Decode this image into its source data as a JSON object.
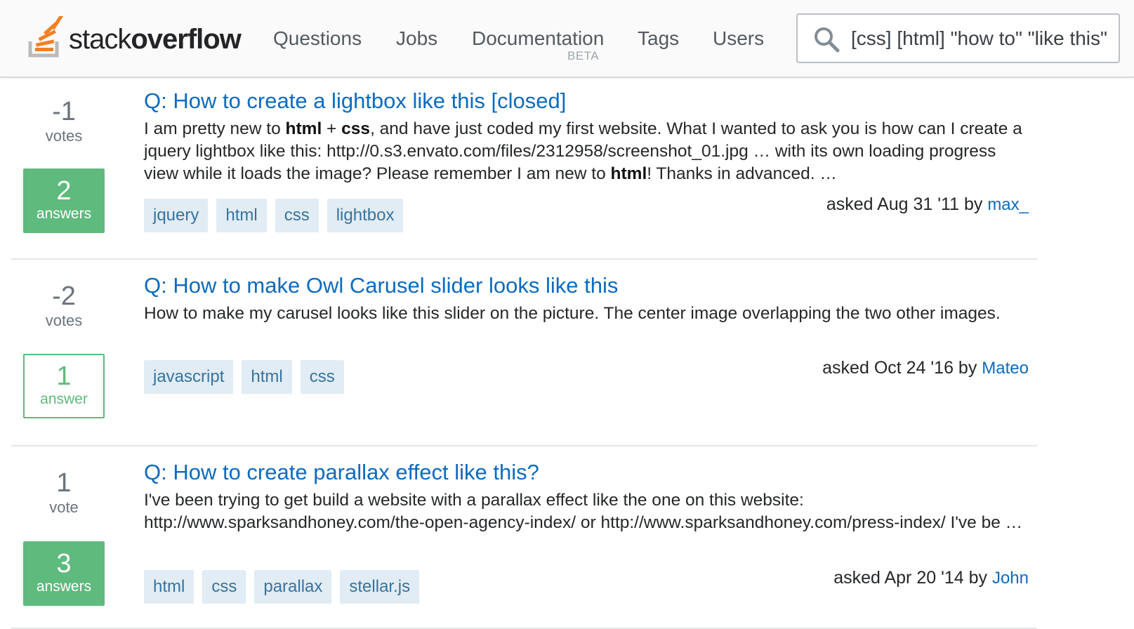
{
  "header": {
    "logo": {
      "light": "stack",
      "bold": "overflow"
    },
    "nav": [
      {
        "label": "Questions"
      },
      {
        "label": "Jobs"
      },
      {
        "label": "Documentation",
        "badge": "BETA"
      },
      {
        "label": "Tags"
      },
      {
        "label": "Users"
      }
    ],
    "search": {
      "value": "[css] [html] \"how to\" \"like this\"",
      "icon": "search-icon"
    }
  },
  "results": [
    {
      "votes": "-1",
      "votes_label": "votes",
      "answers": "2",
      "answers_label": "answers",
      "accepted": true,
      "title": "Q: How to create a lightbox like this [closed]",
      "excerpt": [
        {
          "t": "I am pretty new to "
        },
        {
          "t": "html",
          "b": true
        },
        {
          "t": " + "
        },
        {
          "t": "css",
          "b": true
        },
        {
          "t": ", and have just coded my first website. What I wanted to ask you is how can I create a jquery lightbox like this: http://0.s3.envato.com/files/2312958/screenshot_01.jpg … with its own loading progress view while it loads the image? Please remember I am new to "
        },
        {
          "t": "html",
          "b": true
        },
        {
          "t": "! Thanks in advanced. …"
        }
      ],
      "tags": [
        "jquery",
        "html",
        "css",
        "lightbox"
      ],
      "asked": "asked Aug 31 '11 by",
      "user": "max_"
    },
    {
      "votes": "-2",
      "votes_label": "votes",
      "answers": "1",
      "answers_label": "answer",
      "accepted": false,
      "title": "Q: How to make Owl Carusel slider looks like this",
      "excerpt": [
        {
          "t": "How to make my carusel looks like this slider on the picture. The center image overlapping the two other images."
        }
      ],
      "tags": [
        "javascript",
        "html",
        "css"
      ],
      "asked": "asked Oct 24 '16 by",
      "user": "Mateo"
    },
    {
      "votes": "1",
      "votes_label": "vote",
      "answers": "3",
      "answers_label": "answers",
      "accepted": true,
      "title": "Q: How to create parallax effect like this?",
      "excerpt": [
        {
          "t": "I've been trying to get build a website with a parallax effect like the one on this website: http://www.sparksandhoney.com/the-open-agency-index/ or http://www.sparksandhoney.com/press-index/ I've be …"
        }
      ],
      "tags": [
        "html",
        "css",
        "parallax",
        "stellar.js"
      ],
      "asked": "asked Apr 20 '14 by",
      "user": "John"
    }
  ],
  "colors": {
    "link": "#0c6bbf",
    "accepted": "#5fba7d",
    "tag_bg": "#e1ecf4",
    "tag_text": "#39739d",
    "logo_orange": "#f48024",
    "logo_gray": "#bcbbbb"
  }
}
